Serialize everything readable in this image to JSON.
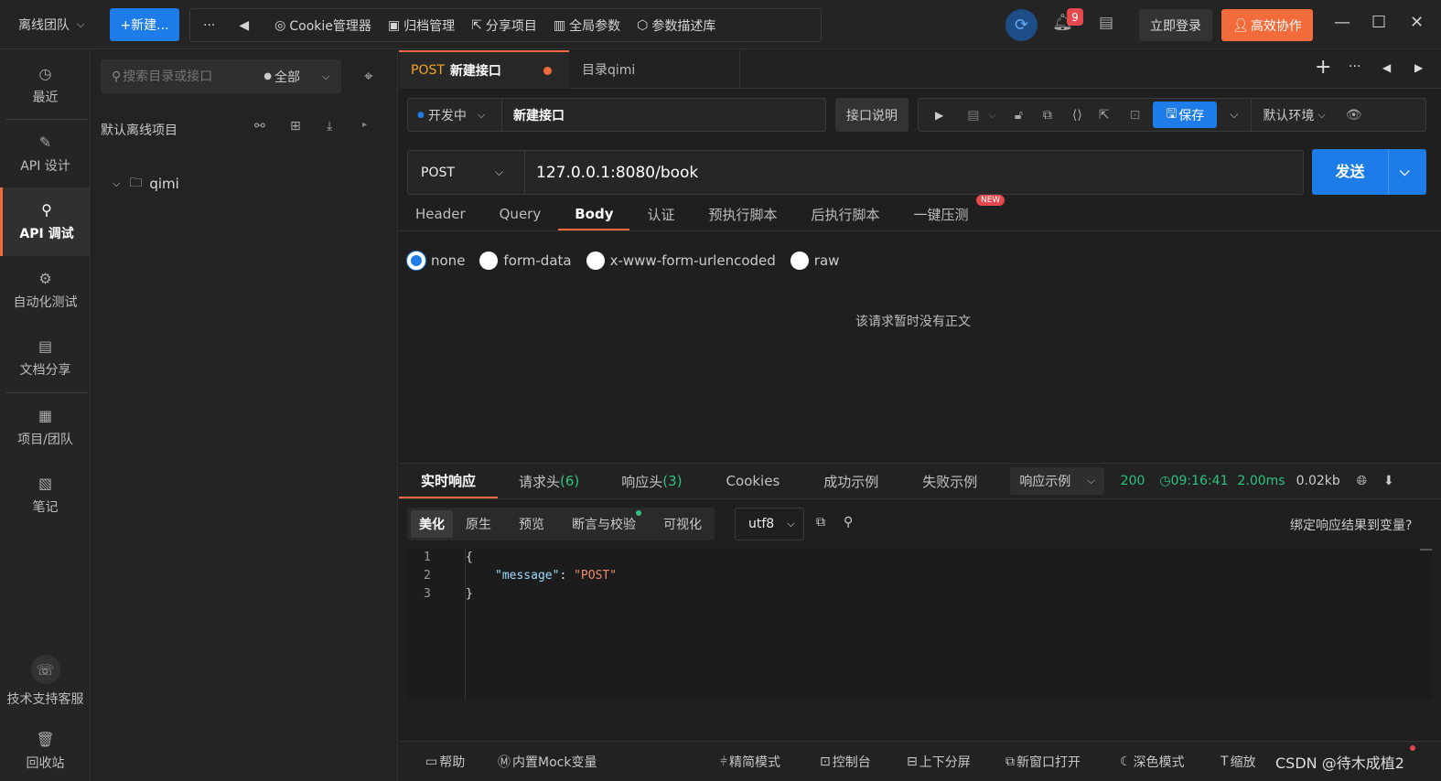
{
  "topbar": {
    "team": "离线团队",
    "new_button": "+新建...",
    "more": "···",
    "back": "◀",
    "tools": [
      {
        "icon": "cookie-icon",
        "glyph": "◎",
        "label": "Cookie管理器"
      },
      {
        "icon": "archive-icon",
        "glyph": "▣",
        "label": "归档管理"
      },
      {
        "icon": "share-icon",
        "glyph": "⇱",
        "label": "分享项目"
      },
      {
        "icon": "global-params-icon",
        "glyph": "▥",
        "label": "全局参数"
      },
      {
        "icon": "cube-icon",
        "glyph": "⬡",
        "label": "参数描述库"
      }
    ],
    "notification_count": "9",
    "login": "立即登录",
    "collaborate": "高效协作"
  },
  "rail": {
    "items": [
      {
        "name": "rail-recent",
        "icon": "clock-icon",
        "glyph": "◷",
        "label": "最近"
      },
      {
        "name": "rail-api-design",
        "icon": "edit-icon",
        "glyph": "✎",
        "label": "API 设计"
      },
      {
        "name": "rail-api-debug",
        "icon": "debug-icon",
        "glyph": "⚲",
        "label": "API 调试"
      },
      {
        "name": "rail-auto-test",
        "icon": "flow-icon",
        "glyph": "⚙",
        "label": "自动化测试"
      },
      {
        "name": "rail-doc-share",
        "icon": "doc-share-icon",
        "glyph": "▤",
        "label": "文档分享"
      },
      {
        "name": "rail-project-team",
        "icon": "folder-icon",
        "glyph": "▦",
        "label": "项目/团队"
      },
      {
        "name": "rail-notes",
        "icon": "notes-icon",
        "glyph": "▧",
        "label": "笔记"
      },
      {
        "name": "rail-support",
        "icon": "support-icon",
        "glyph": "☏",
        "label": "技术支持客服"
      },
      {
        "name": "rail-trash",
        "icon": "trash-icon",
        "glyph": "🗑",
        "label": "回收站"
      }
    ]
  },
  "tree": {
    "search_placeholder": "搜索目录或接口",
    "filter": "全部",
    "project": "默认离线项目",
    "folder": "qimi"
  },
  "tabs": {
    "active_method": "POST",
    "active_name": "新建接口",
    "second": "目录qimi"
  },
  "request": {
    "status": "开发中",
    "name": "新建接口",
    "doc_button": "接口说明",
    "save": "保存",
    "env": "默认环境",
    "method": "POST",
    "url": "127.0.0.1:8080/book",
    "send": "发送"
  },
  "subtabs": [
    "Header",
    "Query",
    "Body",
    "认证",
    "预执行脚本",
    "后执行脚本",
    "一键压测"
  ],
  "new_badge": "NEW",
  "body_types": [
    "none",
    "form-data",
    "x-www-form-urlencoded",
    "raw"
  ],
  "empty_body": "该请求暂时没有正文",
  "response": {
    "tabs": [
      {
        "label": "实时响应",
        "count": ""
      },
      {
        "label": "请求头",
        "count": "(6)"
      },
      {
        "label": "响应头",
        "count": "(3)"
      },
      {
        "label": "Cookies",
        "count": ""
      },
      {
        "label": "成功示例",
        "count": ""
      },
      {
        "label": "失败示例",
        "count": ""
      }
    ],
    "example_select": "响应示例",
    "status": "200",
    "time": "09:16:41",
    "duration": "2.00ms",
    "size": "0.02kb",
    "formats": [
      "美化",
      "原生",
      "预览",
      "断言与校验",
      "可视化"
    ],
    "encoding": "utf8",
    "bind_var": "绑定响应结果到变量?",
    "code_lines": [
      {
        "n": "1",
        "text": "{"
      },
      {
        "n": "2",
        "key": "\"message\"",
        "colon": ": ",
        "value": "\"POST\""
      },
      {
        "n": "3",
        "text": "}"
      }
    ]
  },
  "bottombar": {
    "help": "帮助",
    "mock": "内置Mock变量",
    "precise": "精简模式",
    "console": "控制台",
    "split": "上下分屏",
    "new_window": "新窗口打开",
    "dark": "深色模式",
    "zoom": "缩放",
    "watermark": "CSDN @待木成植2"
  },
  "colors": {
    "accent": "#f26b3a",
    "primary": "#1e7ce8",
    "success": "#2ec27e"
  }
}
